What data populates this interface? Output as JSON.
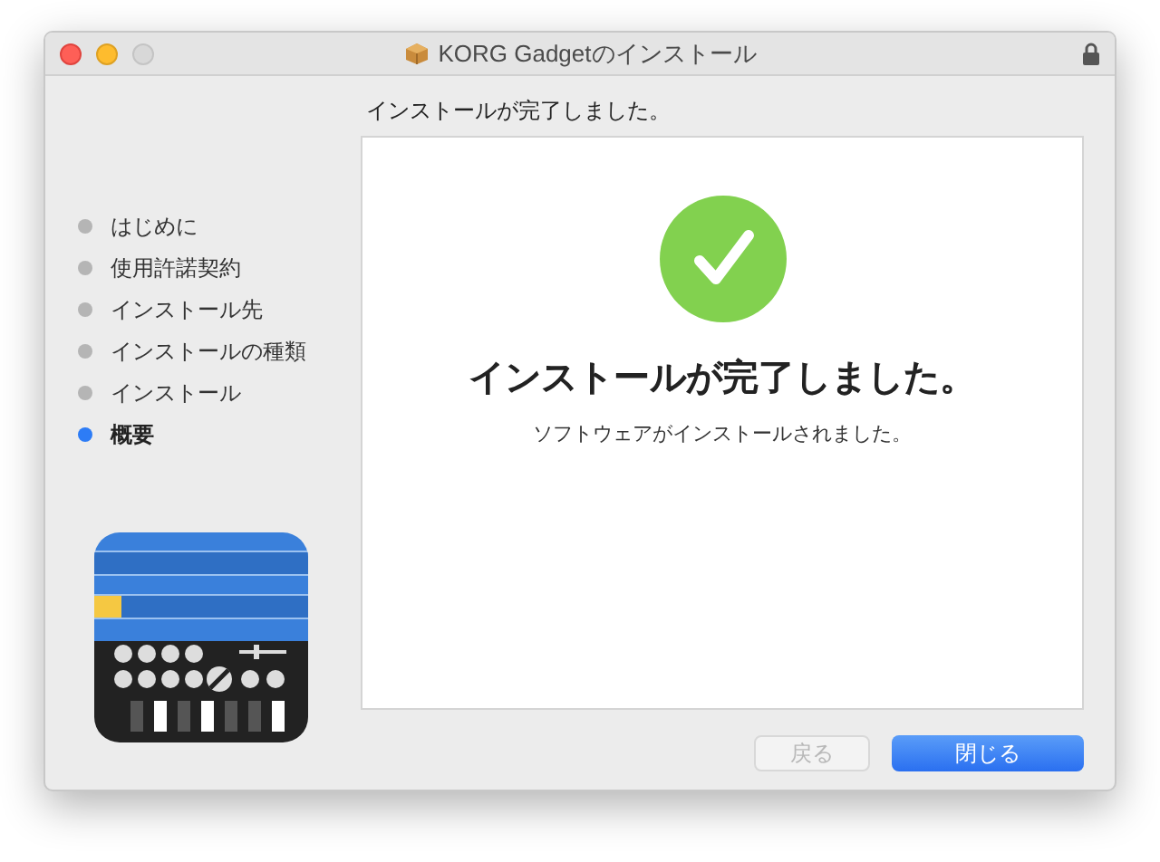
{
  "window": {
    "title": "KORG Gadgetのインストール"
  },
  "heading": "インストールが完了しました。",
  "steps": [
    {
      "label": "はじめに",
      "selected": false
    },
    {
      "label": "使用許諾契約",
      "selected": false
    },
    {
      "label": "インストール先",
      "selected": false
    },
    {
      "label": "インストールの種類",
      "selected": false
    },
    {
      "label": "インストール",
      "selected": false
    },
    {
      "label": "概要",
      "selected": true
    }
  ],
  "panel": {
    "title": "インストールが完了しました。",
    "message": "ソフトウェアがインストールされました。"
  },
  "buttons": [
    {
      "label": "戻る",
      "kind": "secondary",
      "disabled": true
    },
    {
      "label": "閉じる",
      "kind": "primary",
      "disabled": false
    }
  ]
}
